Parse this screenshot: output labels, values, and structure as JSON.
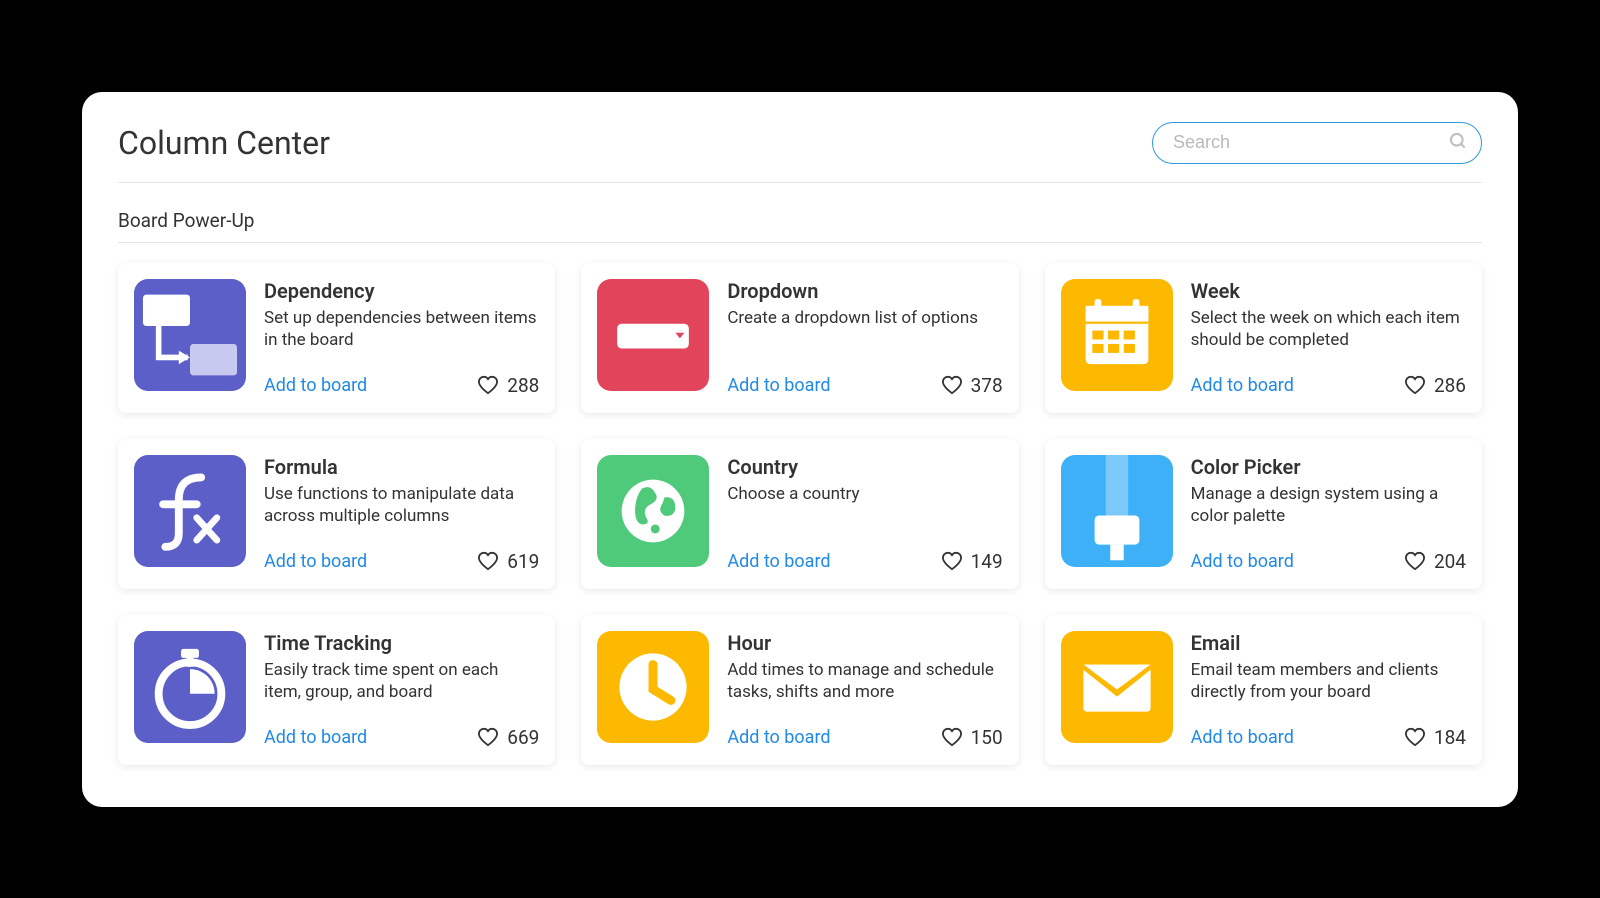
{
  "header": {
    "title": "Column Center",
    "search_placeholder": "Search"
  },
  "section_label": "Board Power-Up",
  "add_label": "Add to board",
  "cards": [
    {
      "id": "dependency",
      "title": "Dependency",
      "desc": "Set up dependencies between items in the board",
      "likes": 288,
      "icon": "dependency",
      "bg": "bg-purple"
    },
    {
      "id": "dropdown",
      "title": "Dropdown",
      "desc": "Create a dropdown list of options",
      "likes": 378,
      "icon": "dropdown",
      "bg": "bg-pink"
    },
    {
      "id": "week",
      "title": "Week",
      "desc": "Select the week on which each item should be completed",
      "likes": 286,
      "icon": "calendar",
      "bg": "bg-yellow"
    },
    {
      "id": "formula",
      "title": "Formula",
      "desc": "Use functions to manipulate data across multiple columns",
      "likes": 619,
      "icon": "formula",
      "bg": "bg-purple"
    },
    {
      "id": "country",
      "title": "Country",
      "desc": "Choose a country",
      "likes": 149,
      "icon": "globe",
      "bg": "bg-green"
    },
    {
      "id": "color-picker",
      "title": "Color Picker",
      "desc": "Manage a design system using a color palette",
      "likes": 204,
      "icon": "brush",
      "bg": "bg-blue"
    },
    {
      "id": "time-tracking",
      "title": "Time Tracking",
      "desc": "Easily track time spent on each item, group, and board",
      "likes": 669,
      "icon": "stopwatch",
      "bg": "bg-purple"
    },
    {
      "id": "hour",
      "title": "Hour",
      "desc": "Add times to manage and schedule tasks, shifts and more",
      "likes": 150,
      "icon": "clock",
      "bg": "bg-yellow"
    },
    {
      "id": "email",
      "title": "Email",
      "desc": "Email team members and clients directly from your board",
      "likes": 184,
      "icon": "mail",
      "bg": "bg-yellow"
    }
  ]
}
